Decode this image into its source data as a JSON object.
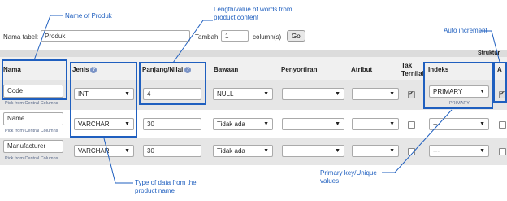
{
  "top": {
    "nama_tabel_label": "Nama tabel:",
    "nama_tabel_value": "Produk",
    "tambah_label": "Tambah",
    "tambah_value": "1",
    "columns_label": "column(s)",
    "go_label": "Go"
  },
  "struktur_label": "Struktur",
  "headers": {
    "nama": "Nama",
    "jenis": "Jenis",
    "panjang": "Panjang/Nilai",
    "bawaan": "Bawaan",
    "penyortiran": "Penyortiran",
    "atribut": "Atribut",
    "tak_ternilai": "Tak Ternilai",
    "indeks": "Indeks",
    "ai": "A_I"
  },
  "pick_label": "Pick from Central Columns",
  "rows": [
    {
      "nama": "Code",
      "jenis": "INT",
      "panjang": "4",
      "bawaan": "NULL",
      "indeks": "PRIMARY",
      "indeks_sub": "PRIMARY",
      "tak_ternilai": true,
      "ai": true
    },
    {
      "nama": "Name",
      "jenis": "VARCHAR",
      "panjang": "30",
      "bawaan": "Tidak ada",
      "indeks": "---",
      "tak_ternilai": false,
      "ai": false
    },
    {
      "nama": "Manufacturer",
      "jenis": "VARCHAR",
      "panjang": "30",
      "bawaan": "Tidak ada",
      "indeks": "---",
      "tak_ternilai": false,
      "ai": false
    }
  ],
  "annotations": {
    "name_of_produk": "Name of Produk",
    "length": "Length/value of words from product content",
    "auto_increment": "Auto increment",
    "type": "Type of data from the product name",
    "primary": "Primary key/Unique values"
  },
  "colors": {
    "annotation": "#1f5fbf",
    "band_light": "#eeeeee",
    "band_dark": "#d9d9d9"
  },
  "icons": {
    "info": "info-icon",
    "dropdown": "chevron-down-icon",
    "check": "check-icon"
  }
}
